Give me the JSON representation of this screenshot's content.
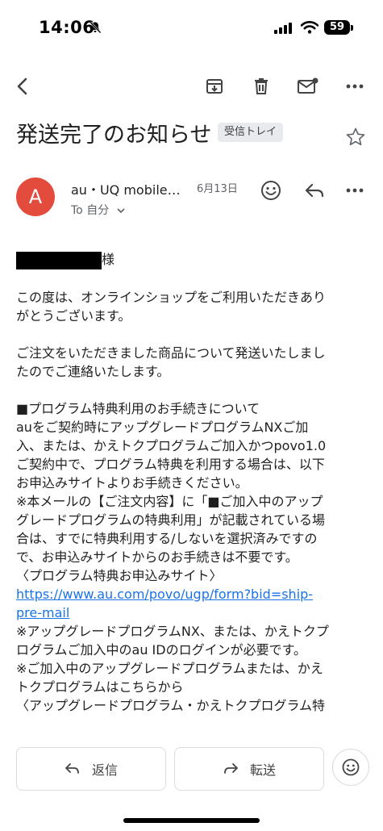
{
  "status_bar": {
    "time": "14:06",
    "battery": "59"
  },
  "email": {
    "subject": "発送完了のお知らせ",
    "label": "受信トレイ",
    "avatar_letter": "A",
    "sender": "au・UQ mobile…",
    "date": "6月13日",
    "to_line": "To 自分"
  },
  "body": {
    "greeting_suffix": "様",
    "para1": [
      "この度は、オンラインショップをご利用いただきあり",
      "がとうございます。"
    ],
    "para2": [
      "ご注文をいただきました商品について発送いたしまし",
      "たのでご連絡いたします。"
    ],
    "section": [
      "■プログラム特典利用のお手続きについて",
      "auをご契約時にアップグレードプログラムNXご加",
      "入、または、かえトクプログラムご加入かつpovo1.0",
      "ご契約中で、プログラム特典を利用する場合は、以下",
      "お申込みサイトよりお手続きください。",
      "※本メールの【ご注文内容】に「■ご加入中のアップ",
      "グレードプログラムの特典利用」が記載されている場",
      "合は、すでに特典利用する/しないを選択済みですの",
      "で、お申込みサイトからのお手続きは不要です。",
      "〈プログラム特典お申込みサイト〉"
    ],
    "link_lines": [
      " https://www.au.com/povo/ugp/form?bid=ship-",
      "pre-mail"
    ],
    "after_link": [
      "※アップグレードプログラムNX、または、かえトクプ",
      "ログラムご加入中のau IDのログインが必要です。",
      "※ご加入中のアップグレードプログラムまたは、かえ",
      "トクプログラムはこちらから",
      "〈アップグレードプログラム・かえトクプログラム特"
    ]
  },
  "actions": {
    "reply": "返信",
    "forward": "転送"
  }
}
